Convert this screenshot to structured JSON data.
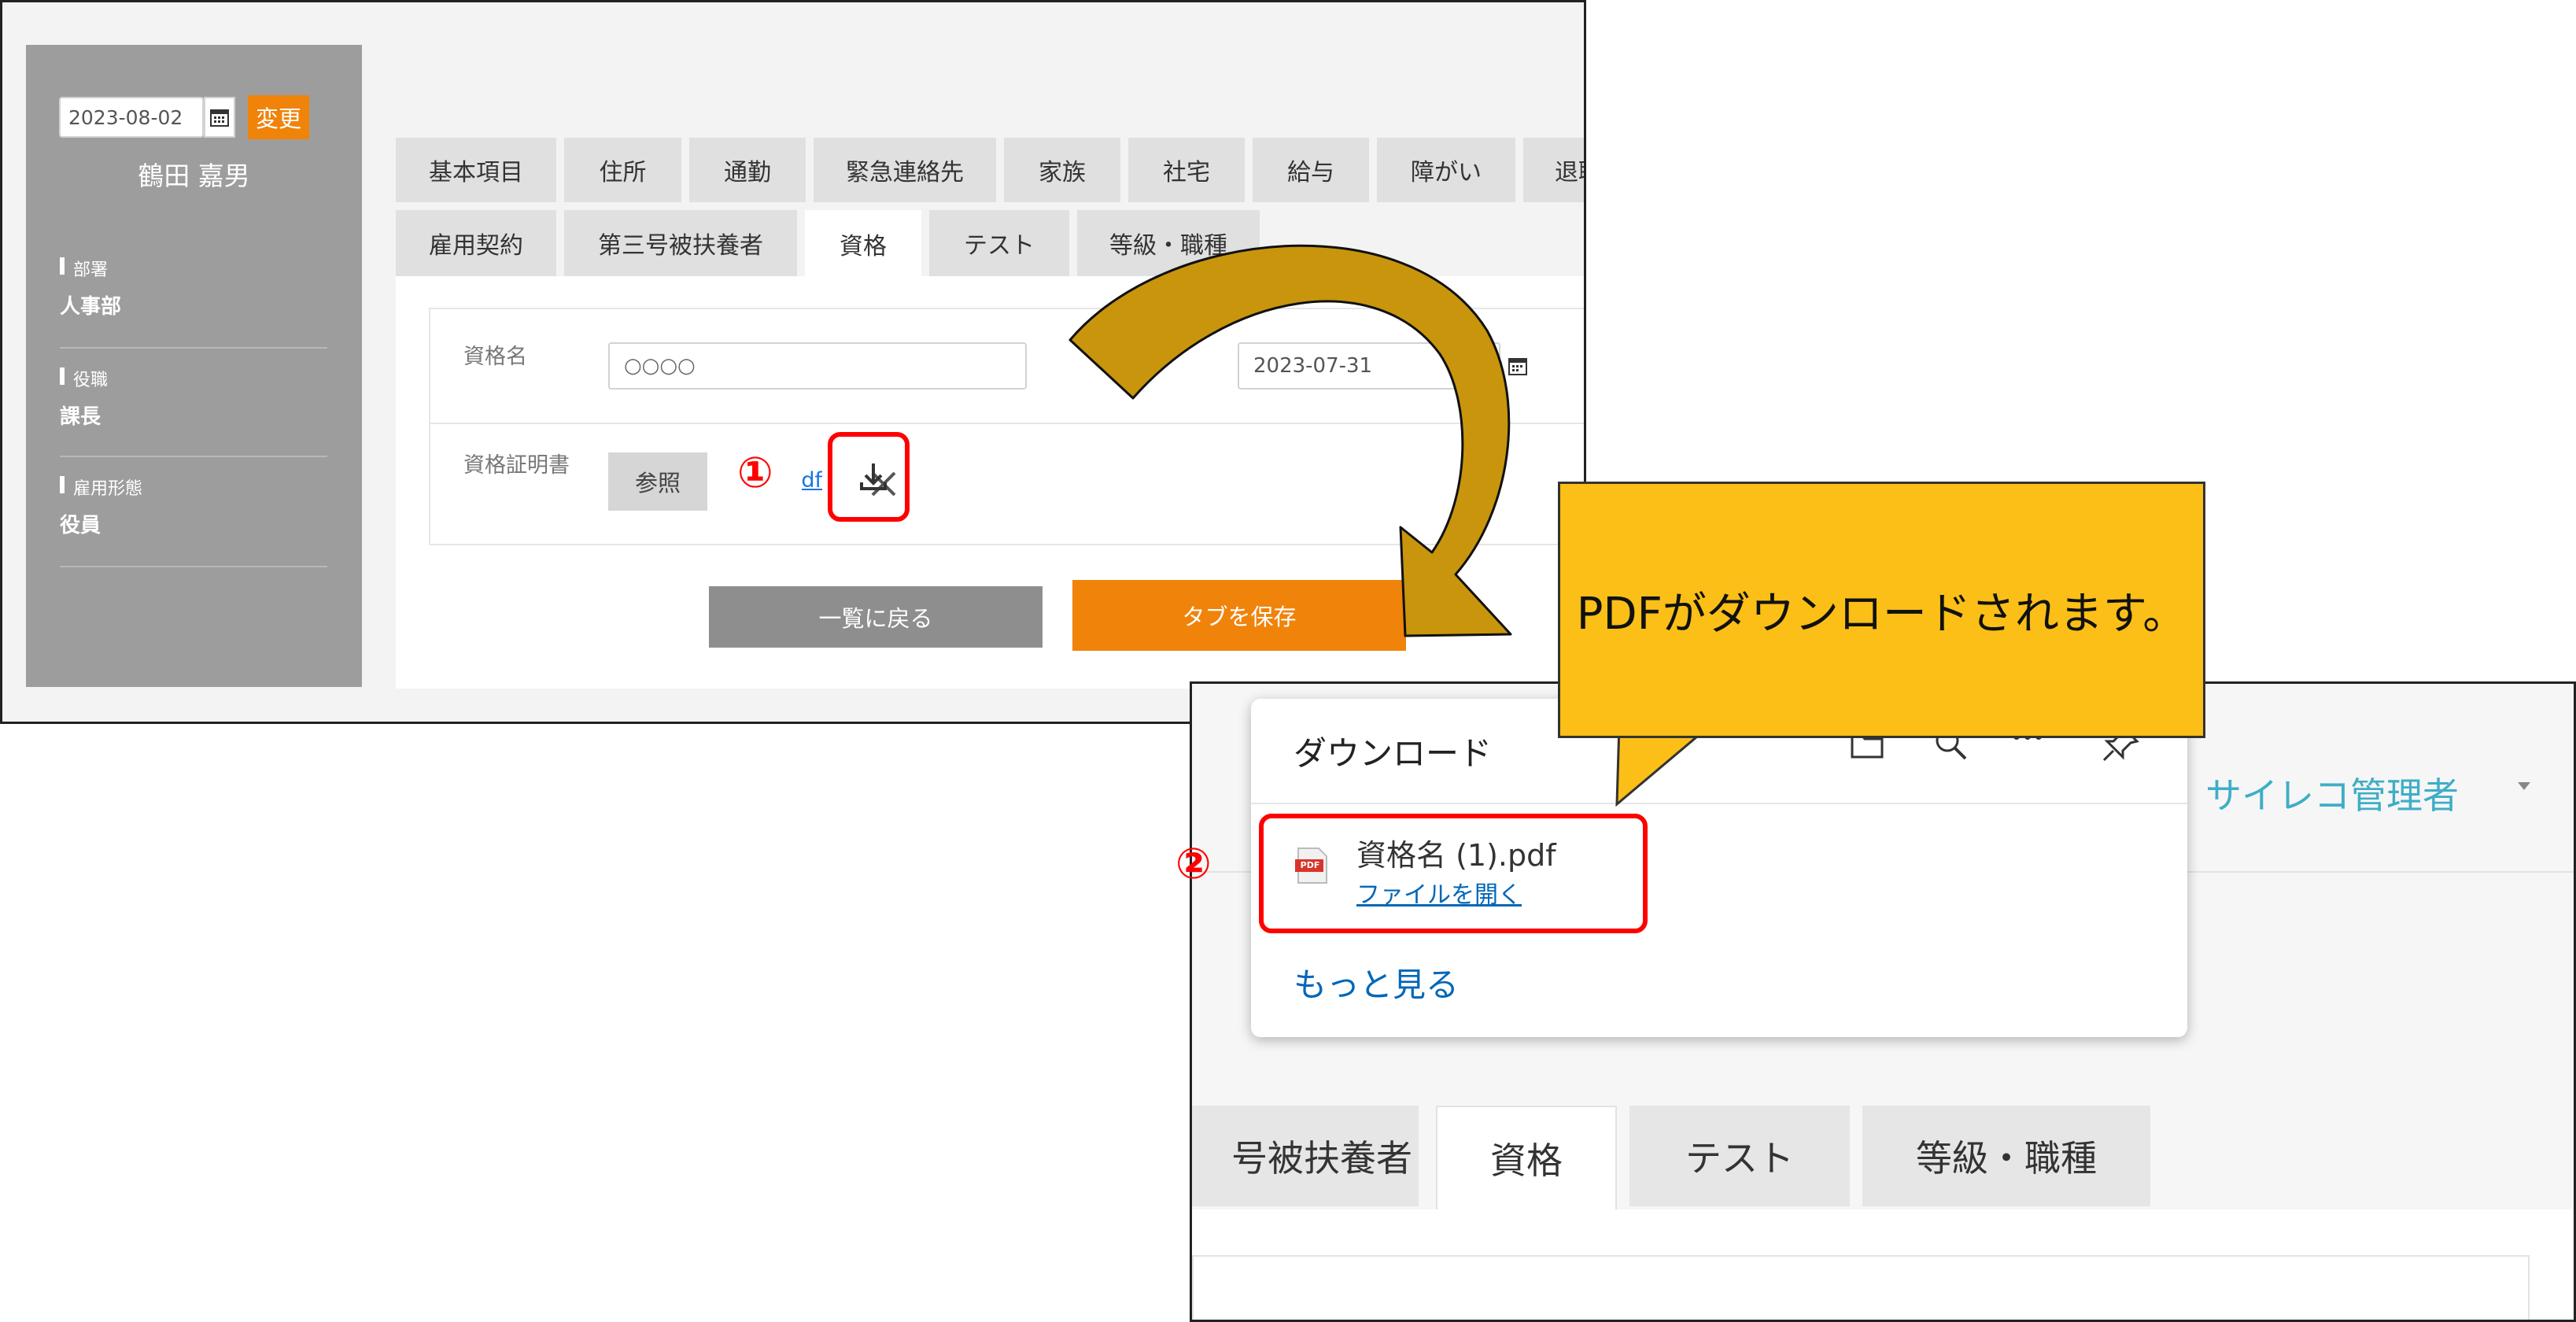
{
  "panel1": {
    "date_value": "2023-08-02",
    "change_button": "変更",
    "employee_name": "鶴田 嘉男",
    "sidebar": [
      {
        "label": "部署",
        "value": "人事部"
      },
      {
        "label": "役職",
        "value": "課長"
      },
      {
        "label": "雇用形態",
        "value": "役員"
      }
    ],
    "tabs_row1": [
      "基本項目",
      "住所",
      "通勤",
      "緊急連絡先",
      "家族",
      "社宅",
      "給与",
      "障がい",
      "退職"
    ],
    "tabs_row2": [
      "雇用契約",
      "第三号被扶養者",
      "資格",
      "テスト",
      "等級・職種"
    ],
    "form": {
      "qualification_name_label": "資格名",
      "qualification_name_value": "○○○○",
      "date_value": "2023-07-31",
      "certificate_label": "資格証明書",
      "browse_button": "参照",
      "file_link": "pdf"
    },
    "back_button": "一覧に戻る",
    "save_button": "タブを保存",
    "step1": "①"
  },
  "callout": {
    "text": "PDFがダウンロードされます。"
  },
  "panel2": {
    "popup_title": "ダウンロード",
    "file_name": "資格名 (1).pdf",
    "open_file": "ファイルを開く",
    "file_badge": "PDF",
    "see_more": "もっと見る",
    "user_label": "サイレコ管理者",
    "step2": "②",
    "tabs": [
      "号被扶養者",
      "資格",
      "テスト",
      "等級・職種"
    ]
  },
  "colors": {
    "accent_orange": "#f0830a",
    "gray_button": "#8e8e8e",
    "sidebar_gray": "#9d9d9d",
    "highlight_red": "#ff0000",
    "callout_yellow": "#fbbf17",
    "arrow_gold": "#c8950c",
    "link_blue": "#0067b8"
  },
  "icons": [
    "calendar-icon",
    "download-icon",
    "close-icon",
    "folder-icon",
    "search-icon",
    "more-icon",
    "pin-icon",
    "pdf-file-icon",
    "chevron-down-icon"
  ]
}
